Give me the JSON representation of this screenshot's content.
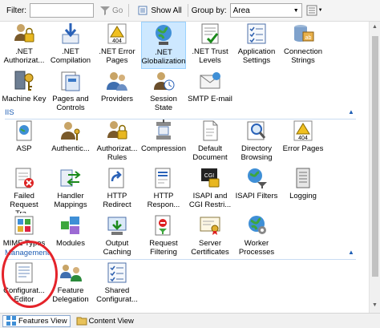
{
  "toolbar": {
    "filter_label": "Filter:",
    "filter_value": "",
    "go_label": "Go",
    "show_all_label": "Show All",
    "group_by_label": "Group by:",
    "group_by_value": "Area"
  },
  "groups": {
    "aspnet": {
      "items": [
        {
          "name": "net-authorization-rules",
          "label": ".NET\nAuthorizat...",
          "icon": "lock-user-icon"
        },
        {
          "name": "net-compilation",
          "label": ".NET\nCompilation",
          "icon": "download-arrow-icon"
        },
        {
          "name": "net-error-pages",
          "label": ".NET Error\nPages",
          "icon": "error-404-icon"
        },
        {
          "name": "net-globalization",
          "label": ".NET\nGlobalization",
          "icon": "globe-icon"
        },
        {
          "name": "net-trust-levels",
          "label": ".NET Trust\nLevels",
          "icon": "certificate-check-icon"
        },
        {
          "name": "application-settings",
          "label": "Application\nSettings",
          "icon": "checklist-icon"
        },
        {
          "name": "connection-strings",
          "label": "Connection\nStrings",
          "icon": "database-ab-icon"
        },
        {
          "name": "machine-key",
          "label": "Machine Key",
          "icon": "machine-key-icon"
        },
        {
          "name": "pages-and-controls",
          "label": "Pages and\nControls",
          "icon": "pages-icon"
        },
        {
          "name": "providers",
          "label": "Providers",
          "icon": "users-icon"
        },
        {
          "name": "session-state",
          "label": "Session State",
          "icon": "session-icon"
        },
        {
          "name": "smtp-email",
          "label": "SMTP E-mail",
          "icon": "mail-icon"
        }
      ]
    },
    "iis": {
      "title": "IIS",
      "items": [
        {
          "name": "asp",
          "label": "ASP",
          "icon": "asp-icon"
        },
        {
          "name": "authentication",
          "label": "Authentic...",
          "icon": "user-key-icon"
        },
        {
          "name": "authorization-rules",
          "label": "Authorizat...\nRules",
          "icon": "lock-user-icon"
        },
        {
          "name": "compression",
          "label": "Compression",
          "icon": "vise-icon"
        },
        {
          "name": "default-document",
          "label": "Default\nDocument",
          "icon": "document-icon"
        },
        {
          "name": "directory-browsing",
          "label": "Directory\nBrowsing",
          "icon": "magnifier-icon"
        },
        {
          "name": "error-pages",
          "label": "Error Pages",
          "icon": "error-warning-icon"
        },
        {
          "name": "failed-request-tracing",
          "label": "Failed\nRequest Tra...",
          "icon": "failed-request-icon"
        },
        {
          "name": "handler-mappings",
          "label": "Handler\nMappings",
          "icon": "handler-arrows-icon"
        },
        {
          "name": "http-redirect",
          "label": "HTTP\nRedirect",
          "icon": "redirect-icon"
        },
        {
          "name": "http-response-headers",
          "label": "HTTP\nRespon...",
          "icon": "response-headers-icon"
        },
        {
          "name": "isapi-cgi-restrictions",
          "label": "ISAPI and\nCGI Restri...",
          "icon": "cgi-icon"
        },
        {
          "name": "isapi-filters",
          "label": "ISAPI Filters",
          "icon": "filter-globe-icon"
        },
        {
          "name": "logging",
          "label": "Logging",
          "icon": "log-book-icon"
        },
        {
          "name": "mime-types",
          "label": "MIME Types",
          "icon": "mime-icon"
        },
        {
          "name": "modules",
          "label": "Modules",
          "icon": "modules-icon"
        },
        {
          "name": "output-caching",
          "label": "Output\nCaching",
          "icon": "cache-icon"
        },
        {
          "name": "request-filtering",
          "label": "Request\nFiltering",
          "icon": "request-filter-icon"
        },
        {
          "name": "server-certificates",
          "label": "Server\nCertificates",
          "icon": "certificate-icon"
        },
        {
          "name": "worker-processes",
          "label": "Worker\nProcesses",
          "icon": "worker-icon"
        }
      ]
    },
    "management": {
      "title": "Management",
      "items": [
        {
          "name": "configuration-editor",
          "label": "Configurat...\nEditor",
          "icon": "config-editor-icon"
        },
        {
          "name": "feature-delegation",
          "label": "Feature\nDelegation",
          "icon": "delegation-icon"
        },
        {
          "name": "shared-configuration",
          "label": "Shared\nConfigurat...",
          "icon": "shared-config-icon"
        }
      ]
    }
  },
  "statusbar": {
    "features_view_label": "Features View",
    "content_view_label": "Content View"
  },
  "colors": {
    "group_header": "#1e5eb4",
    "annotation": "#e4232a",
    "selected": "#cde8ff"
  }
}
